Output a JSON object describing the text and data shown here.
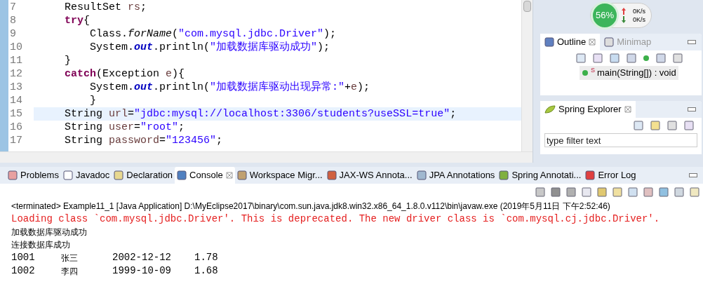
{
  "editor": {
    "lines": [
      {
        "number": "7",
        "current": false,
        "tokens": [
          {
            "kind": "plain",
            "text": "    ResultSet "
          },
          {
            "kind": "local",
            "text": "rs"
          },
          {
            "kind": "plain",
            "text": ";"
          }
        ]
      },
      {
        "number": "8",
        "current": false,
        "tokens": [
          {
            "kind": "keyword",
            "text": "    try"
          },
          {
            "kind": "plain",
            "text": "{"
          }
        ]
      },
      {
        "number": "9",
        "current": false,
        "tokens": [
          {
            "kind": "plain",
            "text": "        Class."
          },
          {
            "kind": "static_method",
            "text": "forName"
          },
          {
            "kind": "plain",
            "text": "("
          },
          {
            "kind": "string",
            "text": "\"com.mysql.jdbc.Driver\""
          },
          {
            "kind": "plain",
            "text": ");"
          }
        ]
      },
      {
        "number": "10",
        "current": false,
        "tokens": [
          {
            "kind": "plain",
            "text": "        System."
          },
          {
            "kind": "static_field",
            "text": "out"
          },
          {
            "kind": "plain",
            "text": ".println("
          },
          {
            "kind": "string",
            "text": "\"加载数据库驱动成功\""
          },
          {
            "kind": "plain",
            "text": ");"
          }
        ]
      },
      {
        "number": "11",
        "current": false,
        "tokens": [
          {
            "kind": "plain",
            "text": "    }"
          }
        ]
      },
      {
        "number": "12",
        "current": false,
        "tokens": [
          {
            "kind": "keyword",
            "text": "    catch"
          },
          {
            "kind": "plain",
            "text": "(Exception "
          },
          {
            "kind": "local",
            "text": "e"
          },
          {
            "kind": "plain",
            "text": "){"
          }
        ]
      },
      {
        "number": "13",
        "current": false,
        "tokens": [
          {
            "kind": "plain",
            "text": "        System."
          },
          {
            "kind": "static_field",
            "text": "out"
          },
          {
            "kind": "plain",
            "text": ".println("
          },
          {
            "kind": "string",
            "text": "\"加载数据库驱动出现异常:\""
          },
          {
            "kind": "plain",
            "text": "+"
          },
          {
            "kind": "local",
            "text": "e"
          },
          {
            "kind": "plain",
            "text": ");"
          }
        ]
      },
      {
        "number": "14",
        "current": false,
        "tokens": [
          {
            "kind": "plain",
            "text": "        }"
          }
        ]
      },
      {
        "number": "15",
        "current": true,
        "tokens": [
          {
            "kind": "plain",
            "text": "    String "
          },
          {
            "kind": "local",
            "text": "url"
          },
          {
            "kind": "plain",
            "text": "="
          },
          {
            "kind": "string",
            "text": "\"jdbc:mysql://localhost:3306/students?useSSL=true\""
          },
          {
            "kind": "plain",
            "text": ";"
          }
        ]
      },
      {
        "number": "16",
        "current": false,
        "tokens": [
          {
            "kind": "plain",
            "text": "    String "
          },
          {
            "kind": "local",
            "text": "user"
          },
          {
            "kind": "plain",
            "text": "="
          },
          {
            "kind": "string",
            "text": "\"root\""
          },
          {
            "kind": "plain",
            "text": ";"
          }
        ]
      },
      {
        "number": "17",
        "current": false,
        "tokens": [
          {
            "kind": "plain",
            "text": "    String "
          },
          {
            "kind": "local",
            "text": "password"
          },
          {
            "kind": "plain",
            "text": "="
          },
          {
            "kind": "string",
            "text": "\"123456\""
          },
          {
            "kind": "plain",
            "text": ";"
          }
        ]
      }
    ]
  },
  "monitor": {
    "percent": "56%",
    "upload": "0K/s",
    "download": "0K/s"
  },
  "outline": {
    "tabs": [
      {
        "label": "Outline",
        "selected": true
      },
      {
        "label": "Minimap",
        "selected": false
      }
    ],
    "items": [
      {
        "modifier": "S",
        "label": "main(String[]) : void",
        "selected": true
      }
    ]
  },
  "spring_explorer": {
    "title": "Spring Explorer",
    "filter": {
      "placeholder": "type filter text"
    }
  },
  "bottom_tabs": [
    {
      "label": "Problems",
      "selected": false
    },
    {
      "label": "Javadoc",
      "selected": false
    },
    {
      "label": "Declaration",
      "selected": false
    },
    {
      "label": "Console",
      "selected": true
    },
    {
      "label": "Workspace Migr...",
      "selected": false
    },
    {
      "label": "JAX-WS Annota...",
      "selected": false
    },
    {
      "label": "JPA Annotations",
      "selected": false
    },
    {
      "label": "Spring Annotati...",
      "selected": false
    },
    {
      "label": "Error Log",
      "selected": false
    }
  ],
  "console": {
    "header": "<terminated> Example11_1 [Java Application] D:\\MyEclipse2017\\binary\\com.sun.java.jdk8.win32.x86_64_1.8.0.v112\\bin\\javaw.exe (2019年5月11日 下午2:52:46)",
    "lines": [
      {
        "kind": "error",
        "text": "Loading class `com.mysql.jdbc.Driver'. This is deprecated. The new driver class is `com.mysql.cj.jdbc.Driver'."
      },
      {
        "kind": "message",
        "text": "加载数据库驱动成功"
      },
      {
        "kind": "message",
        "text": "连接数据库成功"
      }
    ],
    "rows": [
      [
        "1001",
        "张三",
        "2002-12-12",
        "1.78"
      ],
      [
        "1002",
        "李四",
        "1999-10-09",
        "1.68"
      ]
    ]
  }
}
